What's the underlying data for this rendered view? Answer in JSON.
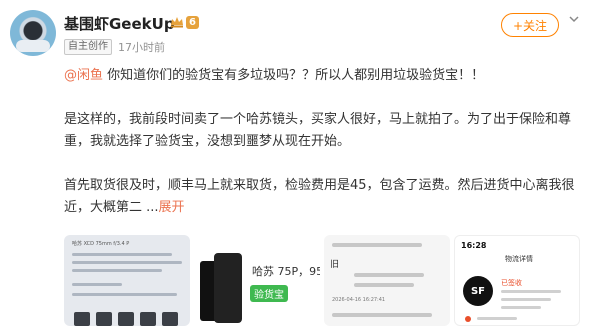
{
  "user": {
    "name": "基围虾GeekUp",
    "vip_level": "6",
    "creator_tag": "自主创作",
    "post_time": "17小时前"
  },
  "actions": {
    "follow_label": "+关注"
  },
  "post": {
    "mention": "@闲鱼",
    "para1_rest": " 你知道你们的验货宝有多垃圾吗？？所以人都别用垃圾验货宝！！",
    "para2": "是这样的，我前段时间卖了一个哈苏镜头，买家人很好，马上就拍了。为了出于保险和尊重，我就选择了验货宝，没想到噩梦从现在开始。",
    "para3": "首先取货很及时，顺丰马上就来取货，检验费用是45，包含了运费。然后进货中心离我很近，大概第二 ...",
    "expand_label": "展开"
  },
  "thumbnails": {
    "t1_header": "哈苏 XCD 75mm f/3.4 P",
    "t2_product": "哈苏 75P，95",
    "t2_brand": "验货宝",
    "t3_mark": "旧",
    "t3_date": "2026-04-16 16:27:41",
    "t4_time": "16:28",
    "t4_title": "物流详情",
    "t4_logo": "SF",
    "t4_status": "已签收"
  },
  "colors": {
    "accent_orange": "#ff8200",
    "link": "#eb7350",
    "text": "#333333",
    "meta": "#939393"
  },
  "icons": [
    "crown-icon",
    "chevron-down-icon"
  ]
}
